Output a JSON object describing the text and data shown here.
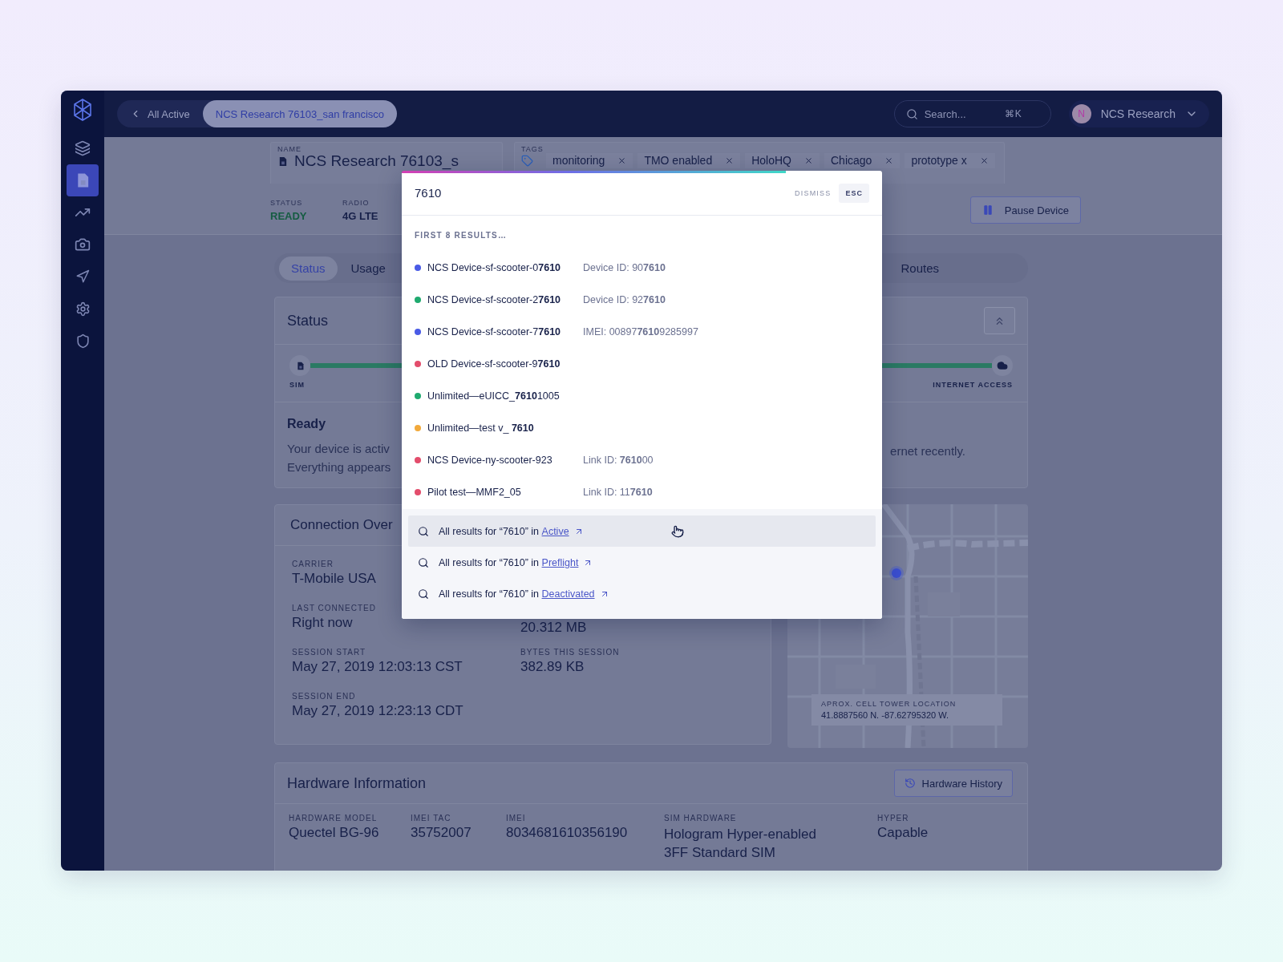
{
  "sidebar": {
    "items": [
      {
        "selected": false
      },
      {
        "selected": true
      },
      {
        "selected": false
      },
      {
        "selected": false
      },
      {
        "selected": false
      },
      {
        "selected": false
      },
      {
        "selected": false
      }
    ]
  },
  "topbar": {
    "breadcrumbs": [
      {
        "label": "All Active",
        "selected": false
      },
      {
        "label": "NCS Research 76103_san francisco",
        "selected": true
      }
    ],
    "search": {
      "placeholder": "Search...",
      "shortcut": "⌘K"
    },
    "account": {
      "initial": "N",
      "name": "NCS Research"
    }
  },
  "device_header": {
    "name_label": "NAME",
    "name": "NCS Research 76103_s",
    "tags_label": "TAGS",
    "tags": [
      "monitoring",
      "TMO enabled",
      "HoloHQ",
      "Chicago",
      "prototype x"
    ],
    "stats": [
      {
        "label": "STATUS",
        "value": "READY",
        "kind": "status"
      },
      {
        "label": "RADIO",
        "value": "4G LTE",
        "kind": "plain"
      }
    ],
    "pause_button": "Pause Device"
  },
  "tabs": [
    {
      "label": "Status",
      "selected": true
    },
    {
      "label": "Usage",
      "selected": false
    },
    {
      "label": "Routes",
      "selected": false
    }
  ],
  "status_card": {
    "title": "Status",
    "steps": [
      "SIM",
      "INTERNET ACCESS"
    ],
    "state": "Ready",
    "message_left": [
      "Your device is activ",
      "Everything appears"
    ],
    "message_right": [
      "ernet recently."
    ]
  },
  "connection": {
    "title": "Connection Over",
    "rows": [
      [
        {
          "label": "CARRIER",
          "value": "T-Mobile USA"
        }
      ],
      [
        {
          "label": "LAST CONNECTED",
          "value": "Right now"
        },
        {
          "value": "20.312 MB"
        }
      ],
      [
        {
          "label": "SESSION START",
          "value": "May 27, 2019  12:03:13 CST"
        },
        {
          "label": "BYTES THIS SESSION",
          "value": "382.89 KB"
        }
      ],
      [
        {
          "label": "SESSION END",
          "value": "May 27, 2019  12:23:13 CDT"
        }
      ]
    ]
  },
  "map": {
    "location_label": "APROX. CELL TOWER LOCATION",
    "coordinates": "41.8887560 N. -87.62795320 W."
  },
  "hardware": {
    "title": "Hardware Information",
    "history_button": "Hardware History",
    "fields": [
      {
        "label": "HARDWARE MODEL",
        "value": "Quectel BG-96"
      },
      {
        "label": "IMEI TAC",
        "value": "35752007"
      },
      {
        "label": "IMEI",
        "value": "8034681610356190"
      },
      {
        "label": "SIM HARDWARE",
        "value": "Hologram Hyper-enabled 3FF Standard SIM"
      },
      {
        "label": "HYPER",
        "value": "Capable"
      }
    ]
  },
  "search_dialog": {
    "query": "7610",
    "dismiss": "DISMISS",
    "key": "ESC",
    "heading": "FIRST 8 RESULTS…",
    "results": [
      {
        "name": "NCS Device-sf-scooter-0**7610**",
        "detail": "Device ID: 90**7610**",
        "color": "#4a5be6"
      },
      {
        "name": "NCS Device-sf-scooter-2**7610**",
        "detail": "Device ID: 92**7610**",
        "color": "#1faa6f"
      },
      {
        "name": "NCS Device-sf-scooter-7**7610**",
        "detail": "IMEI: 00897**7610**9285997",
        "color": "#4a5be6"
      },
      {
        "name": "OLD Device-sf-scooter-9**7610**",
        "color": "#e34d6c"
      },
      {
        "name": "Unlimited—eUICC_**7610**1005",
        "color": "#1faa6f"
      },
      {
        "name": "Unlimited—test v_ **7610**",
        "color": "#f2a93b"
      },
      {
        "name": "NCS Device-ny-scooter-923",
        "detail": "Link ID: **7610**00",
        "color": "#e34d6c"
      },
      {
        "name": "Pilot test—MMF2_05",
        "detail": "Link ID: 11**7610**",
        "color": "#e34d6c"
      }
    ],
    "scopes": [
      {
        "prefix": "All results for “7610” in",
        "link": "Active",
        "selected": true
      },
      {
        "prefix": "All results for “7610” in",
        "link": "Preflight",
        "selected": false
      },
      {
        "prefix": "All results for “7610” in",
        "link": "Deactivated",
        "selected": false
      }
    ]
  }
}
